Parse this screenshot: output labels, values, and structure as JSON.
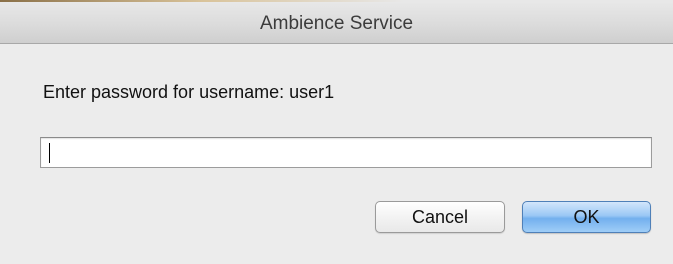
{
  "dialog": {
    "title": "Ambience Service",
    "prompt": "Enter password for username: user1",
    "password_value": "",
    "cancel_label": "Cancel",
    "ok_label": "OK"
  },
  "colors": {
    "window_background": "#ececec",
    "default_button": "#73b0ee",
    "field_background": "#ffffff"
  }
}
